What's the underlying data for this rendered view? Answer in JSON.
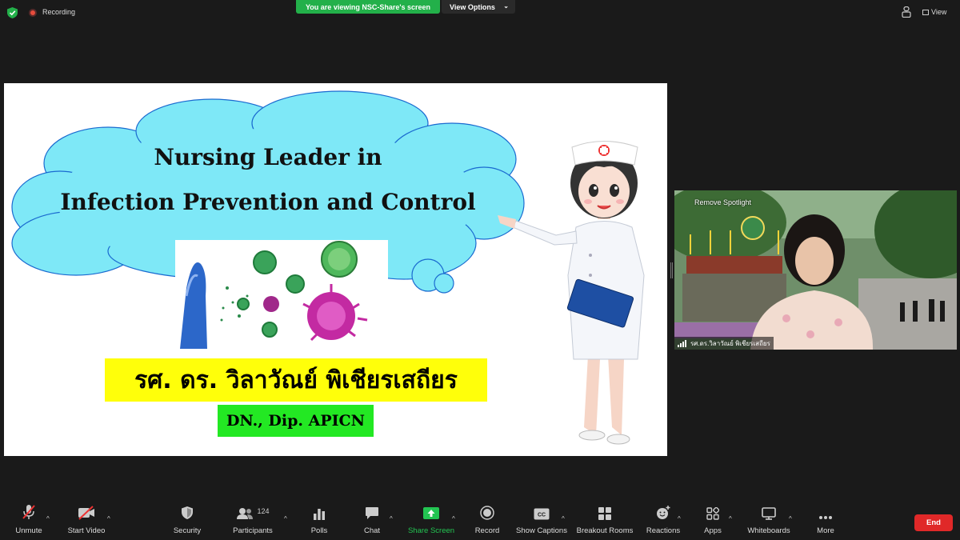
{
  "top": {
    "recording_label": "Recording",
    "banner": "You are viewing NSC-Share's screen",
    "view_options": "View Options",
    "view": "View"
  },
  "slide": {
    "title_line1": "Nursing Leader in",
    "title_line2": "Infection Prevention and Control",
    "presenter_name": "รศ. ดร. วิลาวัณย์ พิเชียรเสถียร",
    "credentials": "DN., Dip. APICN"
  },
  "video": {
    "remove_spotlight": "Remove Spotlight",
    "participant_name": "รศ.ดร.วิลาวัณย์ พิเชียรเสถียร"
  },
  "toolbar": {
    "unmute": "Unmute",
    "start_video": "Start Video",
    "security": "Security",
    "participants": "Participants",
    "participants_count": "124",
    "polls": "Polls",
    "chat": "Chat",
    "share_screen": "Share Screen",
    "record": "Record",
    "show_captions": "Show Captions",
    "breakout_rooms": "Breakout Rooms",
    "reactions": "Reactions",
    "apps": "Apps",
    "whiteboards": "Whiteboards",
    "more": "More",
    "end": "End"
  },
  "colors": {
    "share_green": "#23b04a",
    "end_red": "#e02828",
    "cloud": "#7ee8f7",
    "highlight_yellow": "#ffff0a",
    "highlight_green": "#23e823"
  }
}
